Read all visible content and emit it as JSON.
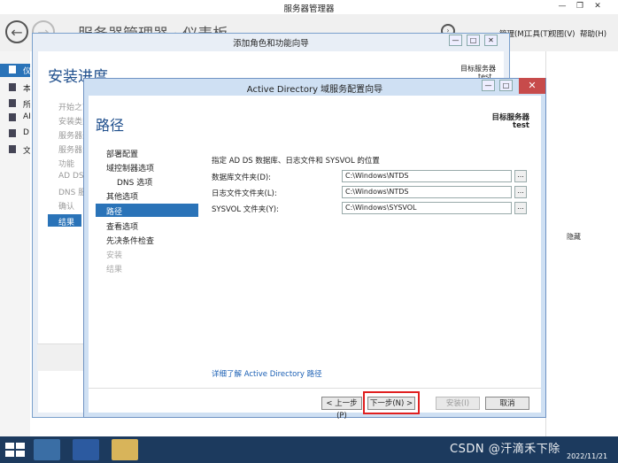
{
  "server_manager": {
    "title": "服务器管理器",
    "breadcrumb": "服务器管理器 · 仪表板",
    "menu": {
      "manage": "管理(M)",
      "tools": "工具(T)",
      "view": "视图(V)",
      "help": "帮助(H)"
    },
    "nav": [
      "仪",
      "本",
      "所",
      "AI",
      "D",
      "文"
    ],
    "hide_label": "隐藏"
  },
  "wizard_roles": {
    "title": "添加角色和功能向导",
    "heading": "安装进度",
    "target_label": "目标服务器",
    "target_server": "test",
    "steps": [
      "开始之前",
      "安装类型",
      "服务器选择",
      "服务器角色",
      "功能",
      "AD DS",
      "DNS 服务器",
      "确认",
      "结果"
    ]
  },
  "wizard_adds": {
    "title": "Active Directory 域服务配置向导",
    "heading": "路径",
    "target_label": "目标服务器",
    "target_server": "test",
    "steps": {
      "deploy": "部署配置",
      "dc_options": "域控制器选项",
      "dns_options": "DNS 选项",
      "other_options": "其他选项",
      "paths": "路径",
      "review": "查看选项",
      "prereq": "先决条件检查",
      "install": "安装",
      "results": "结果"
    },
    "intro": "指定 AD DS 数据库、日志文件和 SYSVOL 的位置",
    "fields": {
      "db_label": "数据库文件夹(D):",
      "db_value": "C:\\Windows\\NTDS",
      "log_label": "日志文件文件夹(L):",
      "log_value": "C:\\Windows\\NTDS",
      "sysvol_label": "SYSVOL 文件夹(Y):",
      "sysvol_value": "C:\\Windows\\SYSVOL",
      "browse": "..."
    },
    "learn_more": "详细了解 Active Directory 路径",
    "buttons": {
      "prev": "< 上一步(P)",
      "next": "下一步(N) >",
      "install": "安装(I)",
      "cancel": "取消"
    }
  },
  "taskbar": {
    "watermark": "CSDN @汗滴禾下除",
    "date": "2022/11/21"
  },
  "colors": {
    "accent": "#2a73b8",
    "highlight": "#e02020",
    "taskbar": "#1c3a5e"
  }
}
